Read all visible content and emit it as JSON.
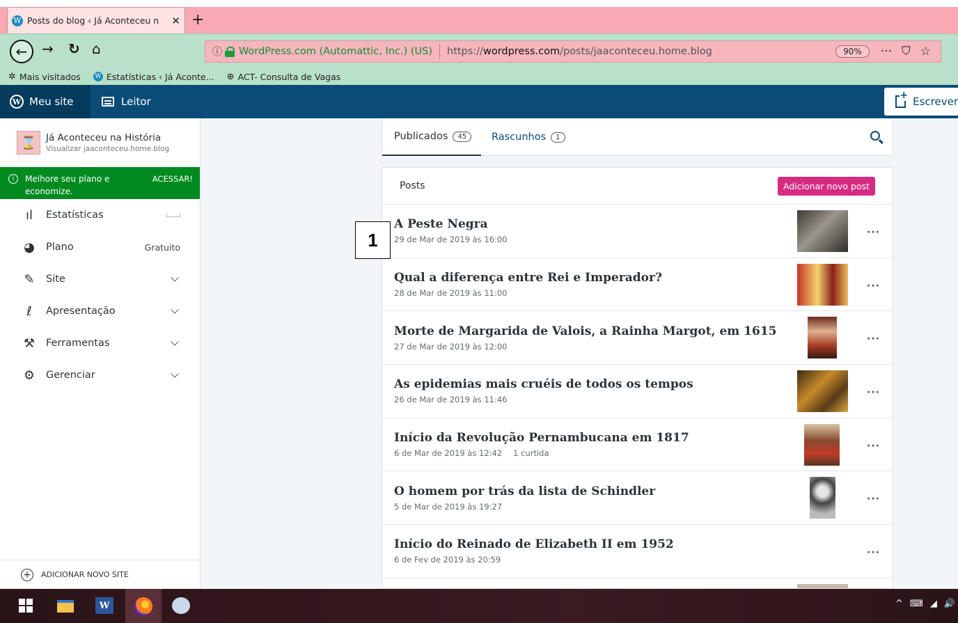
{
  "browser": {
    "tab_title": "Posts do blog ‹ Já Aconteceu n",
    "tab_close": "✕",
    "new_tab": "+",
    "identity": "WordPress.com (Automattic, Inc.) (US)",
    "url_prefix": "https://",
    "url_domain": "wordpress.com",
    "url_path": "/posts/jaaconteceu.home.blog",
    "zoom": "90%",
    "actions": [
      "···",
      "⛉",
      "☆"
    ],
    "bookmarks": [
      {
        "icon": "gear-icon",
        "label": "Mais visitados"
      },
      {
        "icon": "wordpress-icon",
        "label": "Estatísticas ‹ Já Aconte..."
      },
      {
        "icon": "globe-icon",
        "label": "ACT- Consulta de Vagas"
      }
    ]
  },
  "masterbar": {
    "my_site": "Meu site",
    "reader": "Leitor",
    "write": "Escrever"
  },
  "sidebar": {
    "site_name": "Já Aconteceu na História",
    "site_url": "Visualizar jaaconteceu.home.blog",
    "upgrade_text": "Melhore seu plano e economize.",
    "upgrade_cta": "ACESSAR!",
    "items": [
      {
        "label": "Estatísticas",
        "meta": "",
        "icon": "stats-icon"
      },
      {
        "label": "Plano",
        "meta": "Gratuito",
        "icon": "plan-icon"
      },
      {
        "label": "Site",
        "meta": "",
        "icon": "pencil-icon"
      },
      {
        "label": "Apresentação",
        "meta": "",
        "icon": "appearance-icon"
      },
      {
        "label": "Ferramentas",
        "meta": "",
        "icon": "tools-icon"
      },
      {
        "label": "Gerenciar",
        "meta": "",
        "icon": "gear-icon"
      }
    ],
    "add_site": "ADICIONAR NOVO SITE"
  },
  "posts": {
    "tab_published": "Publicados",
    "tab_published_count": "45",
    "tab_drafts": "Rascunhos",
    "tab_drafts_count": "1",
    "header": "Posts",
    "add_new": "Adicionar novo post",
    "more": "···",
    "items": [
      {
        "title": "A Peste Negra",
        "date": "29 de Mar de 2019 às 16:00",
        "likes": "",
        "thumb": "#6d6a63"
      },
      {
        "title": "Qual a diferença entre Rei e Imperador?",
        "date": "28 de Mar de 2019 às 11:00",
        "likes": "",
        "thumb": "#b43a22"
      },
      {
        "title": "Morte de Margarida de Valois, a Rainha Margot, em 1615",
        "date": "27 de Mar de 2019 às 12:00",
        "likes": "",
        "thumb": "#7a3a24"
      },
      {
        "title": "As epidemias mais cruéis de todos os tempos",
        "date": "26 de Mar de 2019 às 11:46",
        "likes": "",
        "thumb": "#8a5a22"
      },
      {
        "title": "Início da Revolução Pernambucana em 1817",
        "date": "6 de Mar de 2019 às 12:42",
        "likes": "1 curtida",
        "thumb": "#9a6a48"
      },
      {
        "title": "O homem por trás da lista de Schindler",
        "date": "5 de Mar de 2019 às 19:27",
        "likes": "",
        "thumb": "#8d8d8d"
      },
      {
        "title": "Início do Reinado de Elizabeth II em 1952",
        "date": "6 de Fev de 2019 às 20:59",
        "likes": "",
        "thumb": ""
      }
    ]
  },
  "marker": "1",
  "taskbar": {
    "tray": [
      "^",
      "⌨",
      "◢",
      "🔊"
    ]
  }
}
